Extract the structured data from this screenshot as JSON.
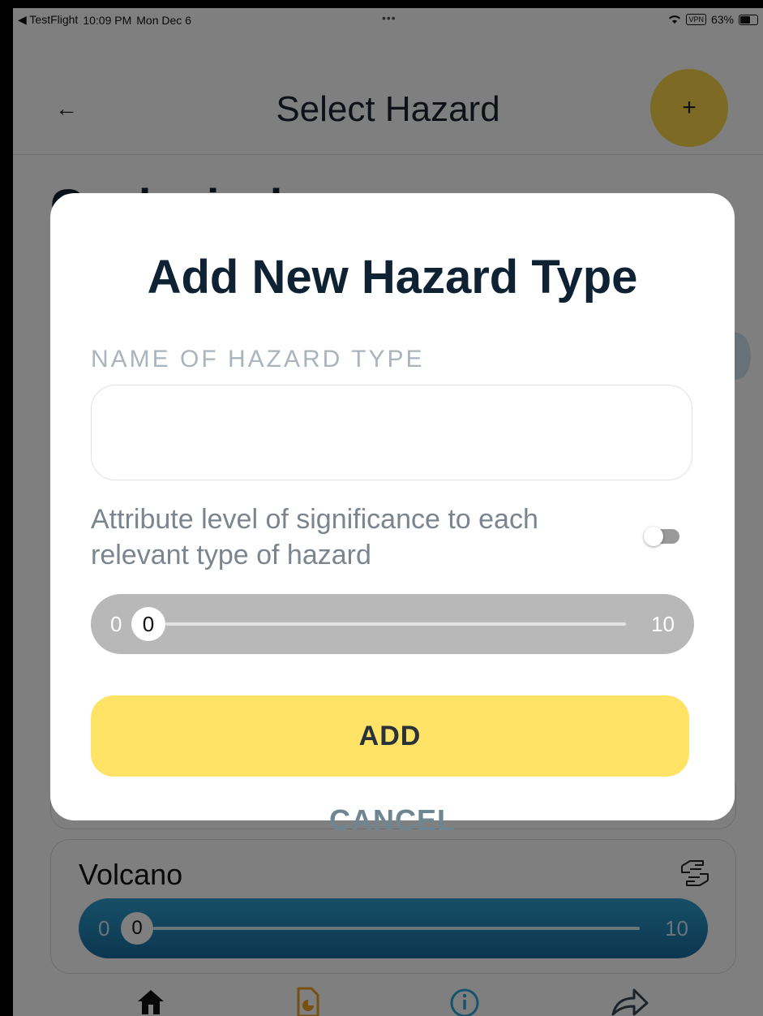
{
  "status_bar": {
    "back_app": "◀ TestFlight",
    "time": "10:09 PM",
    "date": "Mon Dec 6",
    "dots": "•••",
    "vpn": "VPN",
    "battery": "63%"
  },
  "header": {
    "back_icon": "←",
    "title": "Select Hazard",
    "add_icon": "+"
  },
  "section": {
    "title": "Geological"
  },
  "card": {
    "title": "Volcano",
    "icon": "hands-icon",
    "slider": {
      "min": "0",
      "value": "0",
      "max": "10"
    }
  },
  "modal": {
    "title": "Add New Hazard Type",
    "field_label": "NAME OF HAZARD TYPE",
    "name_value": "",
    "significance_text": "Attribute level of significance to each relevant type of hazard",
    "toggle_on": false,
    "slider": {
      "min": "0",
      "value": "0",
      "max": "10"
    },
    "add_label": "ADD",
    "cancel_label": "CANCEL"
  },
  "bottom_nav": [
    {
      "icon": "home-icon",
      "color": "#111111"
    },
    {
      "icon": "report-icon",
      "color": "#f0a020"
    },
    {
      "icon": "info-icon",
      "color": "#2aa8d8"
    },
    {
      "icon": "share-icon",
      "color": "#3a4650"
    }
  ],
  "colors": {
    "accent_yellow": "#fbd54b",
    "button_yellow": "#ffe367",
    "slider_blue": "#2d9fcf",
    "title_dark": "#0e2233"
  }
}
